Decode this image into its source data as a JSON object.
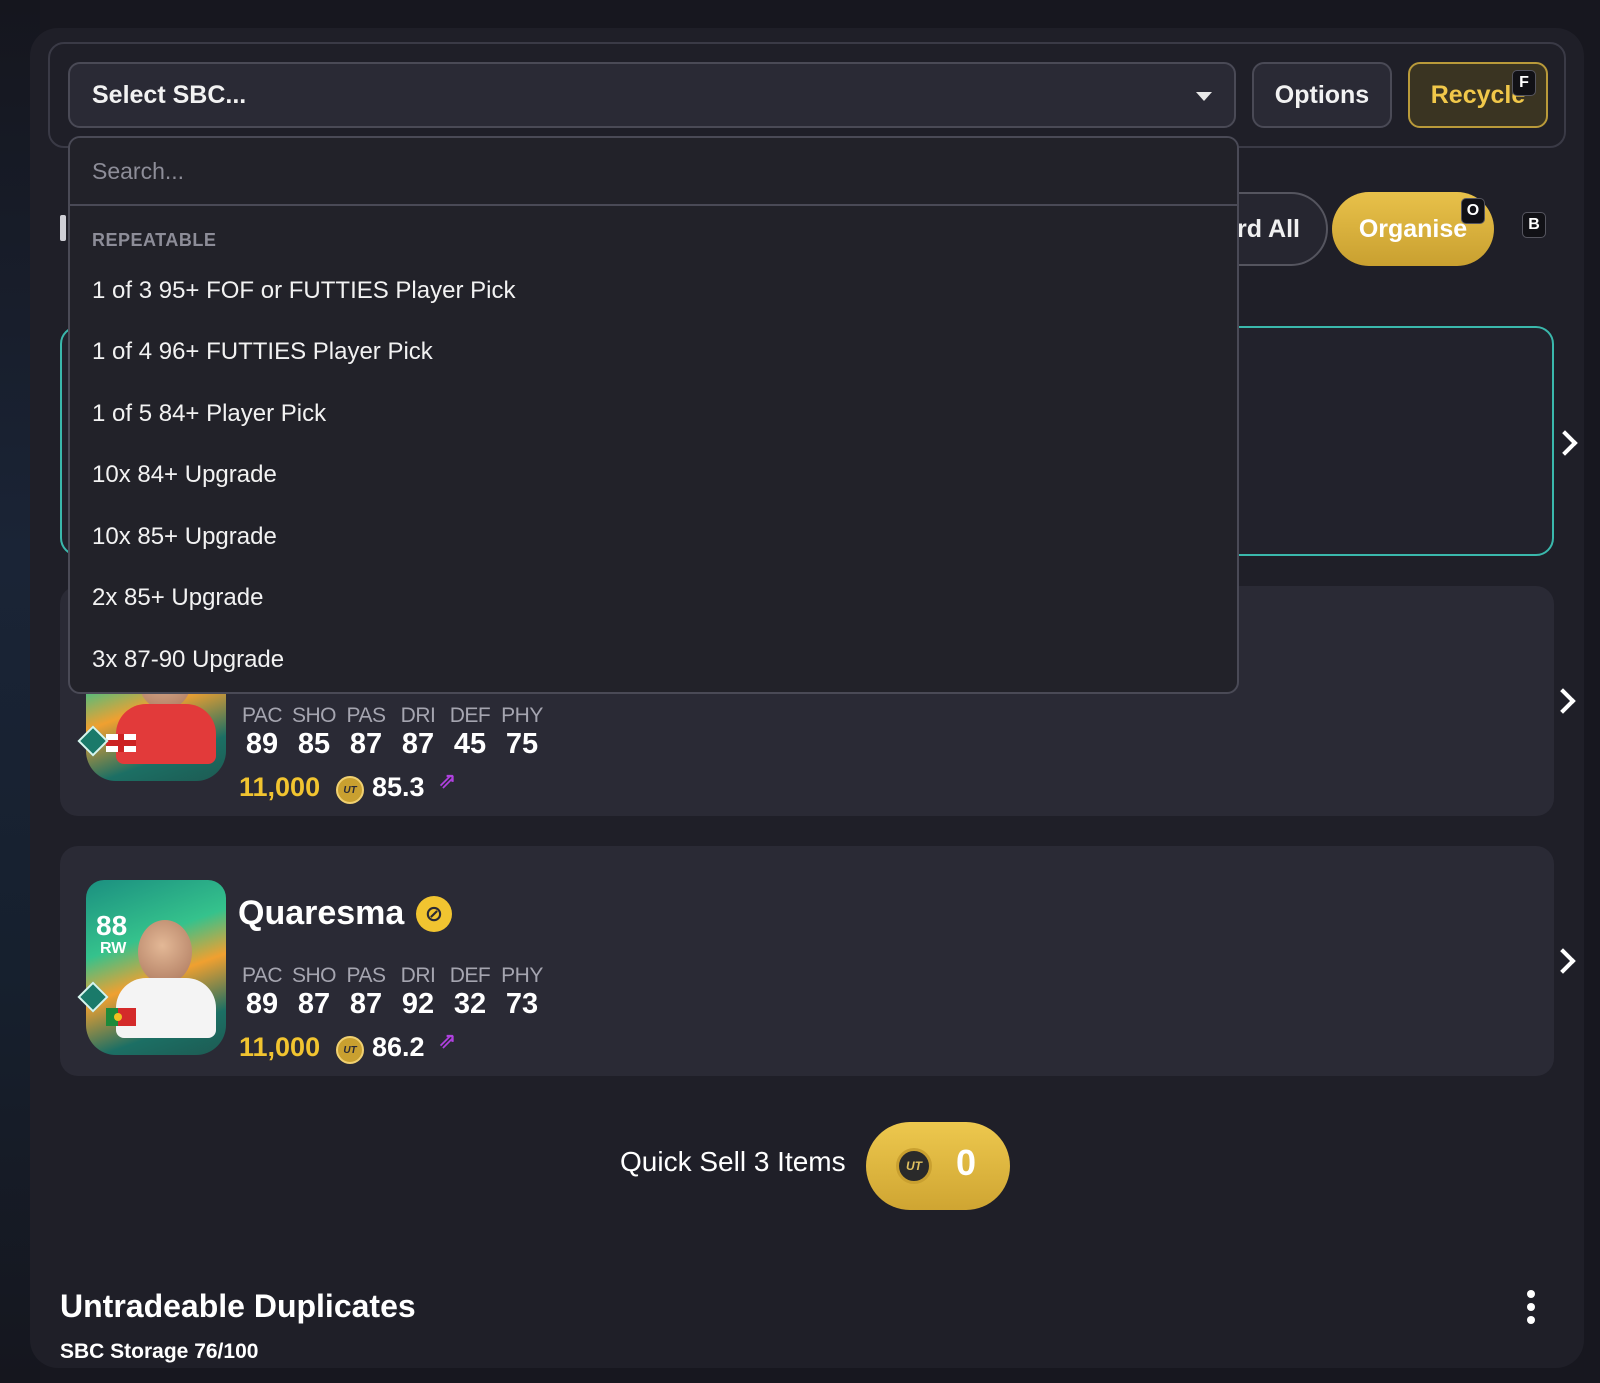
{
  "topbar": {
    "select_label": "Select SBC...",
    "options_label": "Options",
    "recycle_label": "Recycle",
    "recycle_shortcut": "F"
  },
  "toolbar2": {
    "discard_label": "ard All",
    "organise_label": "Organise",
    "organise_shortcut": "O",
    "side_shortcut": "B"
  },
  "dropdown": {
    "search_placeholder": "Search...",
    "group_label": "REPEATABLE",
    "items": [
      "1 of 3 95+ FOF or FUTTIES Player Pick",
      "1 of 4 96+ FUTTIES Player Pick",
      "1 of 5 84+ Player Pick",
      "10x 84+ Upgrade",
      "10x 85+ Upgrade",
      "2x 85+ Upgrade",
      "3x 87-90 Upgrade"
    ]
  },
  "players": [
    {
      "stat_labels": [
        "PAC",
        "SHO",
        "PAS",
        "DRI",
        "DEF",
        "PHY"
      ],
      "stats": [
        "89",
        "85",
        "87",
        "87",
        "45",
        "75"
      ],
      "price": "11,000",
      "coin_label": "UT",
      "avg": "85.3"
    },
    {
      "name": "Quaresma",
      "rating": "88",
      "position": "RW",
      "stat_labels": [
        "PAC",
        "SHO",
        "PAS",
        "DRI",
        "DEF",
        "PHY"
      ],
      "stats": [
        "89",
        "87",
        "87",
        "92",
        "32",
        "73"
      ],
      "price": "11,000",
      "coin_label": "UT",
      "avg": "86.2"
    }
  ],
  "quick_sell": {
    "label": "Quick Sell 3 Items",
    "coin_label": "UT",
    "value": "0"
  },
  "duplicates": {
    "title": "Untradeable Duplicates",
    "storage": "SBC Storage 76/100"
  },
  "colors": {
    "accent_gold": "#f1c430",
    "selected_border": "#3ab8ac",
    "trend_purple": "#b040e0"
  }
}
